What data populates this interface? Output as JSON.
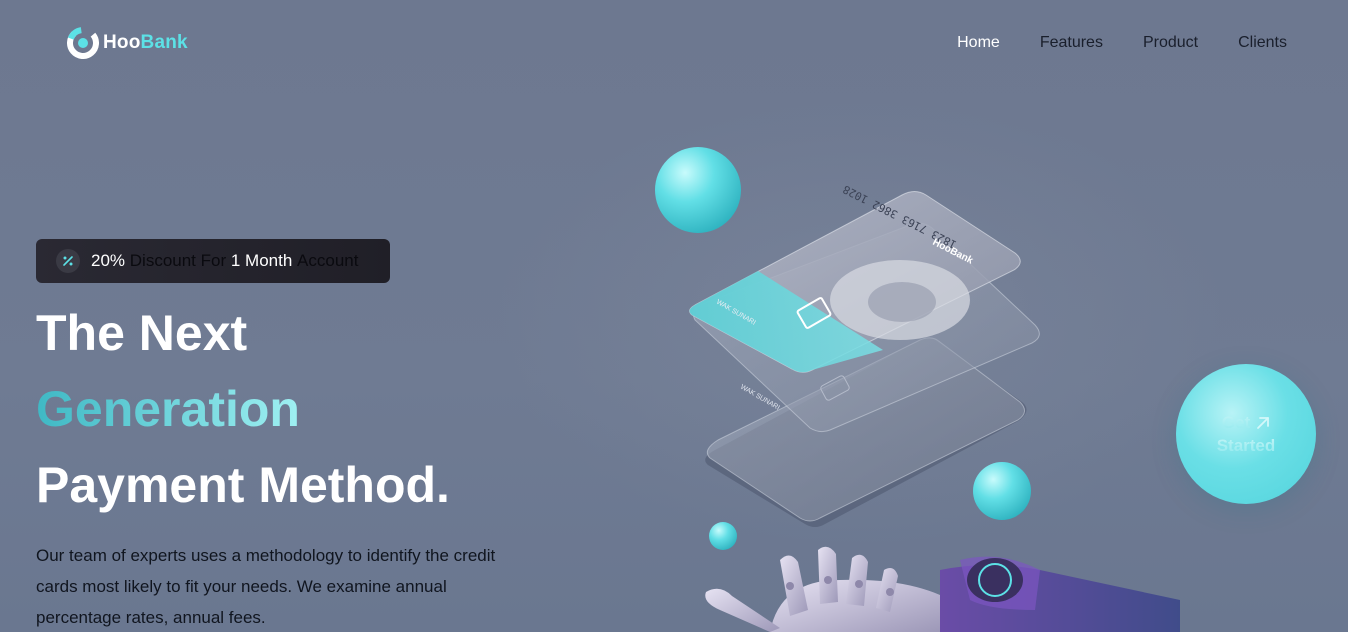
{
  "brand": {
    "name_part1": "Hoo",
    "name_part2": "Bank"
  },
  "nav": {
    "items": [
      {
        "label": "Home",
        "active": true
      },
      {
        "label": "Features",
        "active": false
      },
      {
        "label": "Product",
        "active": false
      },
      {
        "label": "Clients",
        "active": false
      }
    ]
  },
  "badge": {
    "icon": "discount-icon",
    "percent": "20%",
    "text1": "Discount For",
    "duration": "1 Month",
    "text2": "Account"
  },
  "hero": {
    "line1": "The Next",
    "line2": "Generation",
    "line3": "Payment Method.",
    "paragraph": "Our team of experts uses a methodology to identify the credit cards most likely to fit your needs. We examine annual percentage rates, annual fees."
  },
  "cards": {
    "number": "1823 7163 3862 1028",
    "brand": "HooBank",
    "holder": "WAK SUNARI"
  },
  "cta": {
    "line1": "Get",
    "line2": "Started",
    "icon": "arrow-up-right-icon"
  },
  "colors": {
    "accent": "#5ce1e6",
    "background": "#6e7a91",
    "badge": "#24232b"
  }
}
